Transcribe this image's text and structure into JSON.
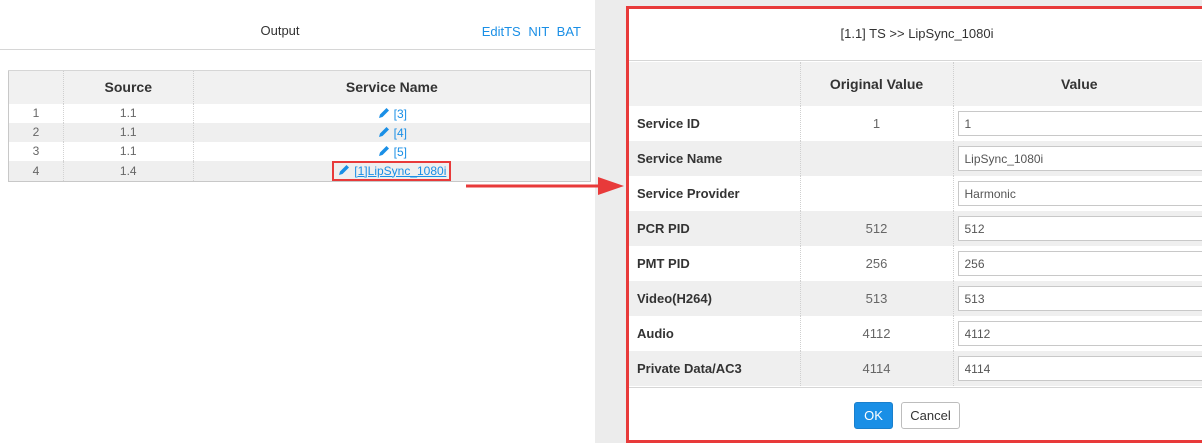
{
  "output_panel": {
    "title": "Output",
    "links": [
      "EditTS",
      "NIT",
      "BAT"
    ],
    "columns": [
      "",
      "Source",
      "Service Name"
    ],
    "rows": [
      {
        "index": "1",
        "source": "1.1",
        "service_name": "[3]"
      },
      {
        "index": "2",
        "source": "1.1",
        "service_name": "[4]"
      },
      {
        "index": "3",
        "source": "1.1",
        "service_name": "[5]"
      },
      {
        "index": "4",
        "source": "1.4",
        "service_name": "[1]LipSync_1080i"
      }
    ]
  },
  "edit_dialog": {
    "title": "[1.1] TS >> LipSync_1080i",
    "columns": [
      "",
      "Original Value",
      "Value"
    ],
    "rows": [
      {
        "label": "Service ID",
        "original": "1",
        "value": "1"
      },
      {
        "label": "Service Name",
        "original": "",
        "value": "LipSync_1080i"
      },
      {
        "label": "Service Provider",
        "original": "",
        "value": "Harmonic"
      },
      {
        "label": "PCR PID",
        "original": "512",
        "value": "512"
      },
      {
        "label": "PMT PID",
        "original": "256",
        "value": "256"
      },
      {
        "label": "Video(H264)",
        "original": "513",
        "value": "513"
      },
      {
        "label": "Audio",
        "original": "4112",
        "value": "4112"
      },
      {
        "label": "Private Data/AC3",
        "original": "4114",
        "value": "4114"
      }
    ],
    "ok_label": "OK",
    "cancel_label": "Cancel"
  },
  "colors": {
    "link": "#1a8fe6",
    "highlight": "#e83a3a",
    "ok_button": "#1a8fe6"
  },
  "icons": {
    "edit": "pencil-icon",
    "annotation": "arrow-right-icon"
  }
}
